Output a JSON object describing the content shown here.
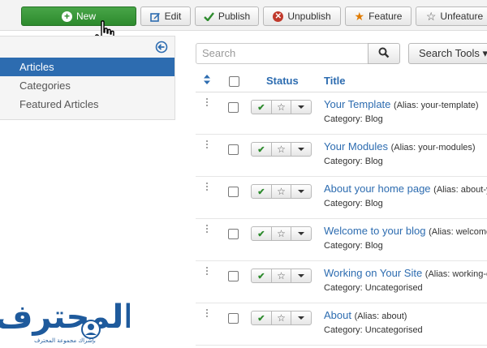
{
  "toolbar": {
    "new_label": "New",
    "edit_label": "Edit",
    "publish_label": "Publish",
    "unpublish_label": "Unpublish",
    "feature_label": "Feature",
    "unfeature_label": "Unfeature"
  },
  "sidebar": {
    "items": [
      {
        "label": "Articles",
        "active": true
      },
      {
        "label": "Categories",
        "active": false
      },
      {
        "label": "Featured Articles",
        "active": false
      }
    ]
  },
  "filters": {
    "search_placeholder": "Search",
    "tools_label": "Search Tools ▾"
  },
  "table": {
    "headers": {
      "status": "Status",
      "title": "Title"
    },
    "rows": [
      {
        "title": "Your Template",
        "alias": "(Alias: your-template)",
        "category": "Category: Blog"
      },
      {
        "title": "Your Modules",
        "alias": "(Alias: your-modules)",
        "category": "Category: Blog"
      },
      {
        "title": "About your home page",
        "alias": "(Alias: about-yo",
        "category": "Category: Blog"
      },
      {
        "title": "Welcome to your blog",
        "alias": "(Alias: welcome",
        "category": "Category: Blog"
      },
      {
        "title": "Working on Your Site",
        "alias": "(Alias: working-o",
        "category": "Category: Uncategorised"
      },
      {
        "title": "About",
        "alias": "(Alias: about)",
        "category": "Category: Uncategorised"
      }
    ]
  },
  "watermark": {
    "logo_text": "المحترف",
    "tagline": "بإشراك مجموعة المحترف"
  },
  "colors": {
    "accent": "#2d6cb0",
    "new_button": "#3a9a3a",
    "published_check": "#2e8b2e",
    "unpublish_icon": "#c0392b",
    "feature_star": "#e07b00"
  }
}
